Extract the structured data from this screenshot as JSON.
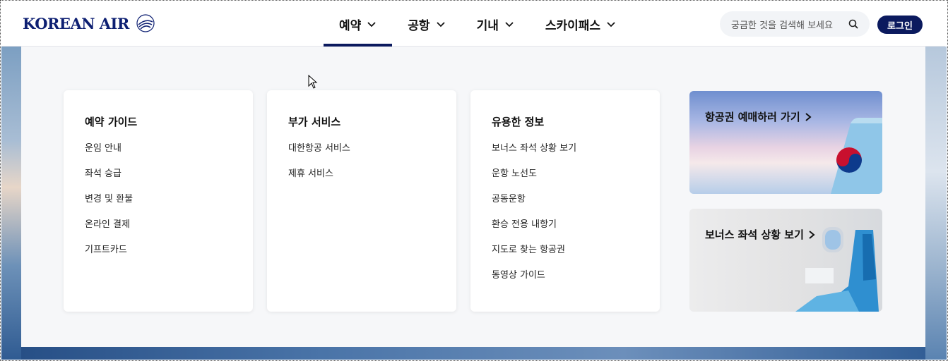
{
  "brand": {
    "logo_text": "KOREAN AIR",
    "primary_color": "#0b1a5e"
  },
  "nav": {
    "items": [
      {
        "label": "예약",
        "active": true
      },
      {
        "label": "공항",
        "active": false
      },
      {
        "label": "기내",
        "active": false
      },
      {
        "label": "스카이패스",
        "active": false
      }
    ]
  },
  "search": {
    "placeholder": "궁금한 것을 검색해 보세요",
    "icon": "search-icon"
  },
  "login": {
    "label": "로그인"
  },
  "menu": {
    "columns": [
      {
        "title": "예약 가이드",
        "items": [
          "운임 안내",
          "좌석 승급",
          "변경 및 환불",
          "온라인 결제",
          "기프트카드"
        ]
      },
      {
        "title": "부가 서비스",
        "items": [
          "대한항공 서비스",
          "제휴 서비스"
        ]
      },
      {
        "title": "유용한 정보",
        "items": [
          "보너스 좌석 상황 보기",
          "운항 노선도",
          "공동운항",
          "환승 전용 내항기",
          "지도로 찾는 항공권",
          "동영상 가이드"
        ]
      }
    ],
    "promos": [
      {
        "label": "항공권 예매하러 가기"
      },
      {
        "label": "보너스 좌석 상황 보기"
      }
    ]
  }
}
